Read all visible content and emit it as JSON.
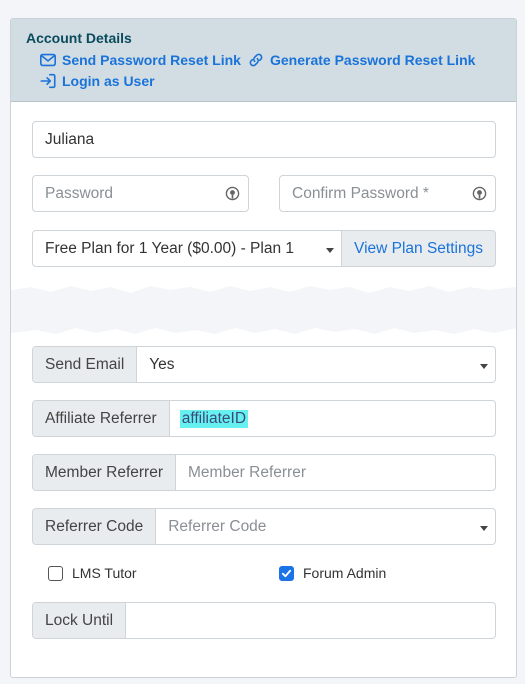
{
  "header": {
    "title": "Account Details",
    "send_reset_link": "Send Password Reset Link",
    "generate_reset_link": "Generate Password Reset Link",
    "login_as_user": "Login as User"
  },
  "form": {
    "first_name_value": "Juliana",
    "password_placeholder": "Password",
    "confirm_password_placeholder": "Confirm Password *",
    "plan_value": "Free Plan for 1 Year ($0.00) - Plan 1",
    "view_plan_settings": "View Plan Settings",
    "send_email_label": "Send Email",
    "send_email_value": "Yes",
    "affiliate_referrer_label": "Affiliate Referrer",
    "affiliate_referrer_value": "affiliateID",
    "member_referrer_label": "Member Referrer",
    "member_referrer_placeholder": "Member Referrer",
    "referrer_code_label": "Referrer Code",
    "referrer_code_placeholder": "Referrer Code",
    "lms_tutor_label": "LMS Tutor",
    "lms_tutor_checked": false,
    "forum_admin_label": "Forum Admin",
    "forum_admin_checked": true,
    "lock_until_label": "Lock Until",
    "lock_until_value": ""
  },
  "icons": {
    "send_reset": "envelope-icon",
    "generate_reset": "link-icon",
    "login_as": "sign-in-icon",
    "password_eye": "eye-icon"
  },
  "colors": {
    "accent": "#1a73d9",
    "header_bg": "#d2dde3",
    "title": "#0a4a5c",
    "highlight": "#66f0f0",
    "checkbox_checked": "#1a73e8"
  }
}
